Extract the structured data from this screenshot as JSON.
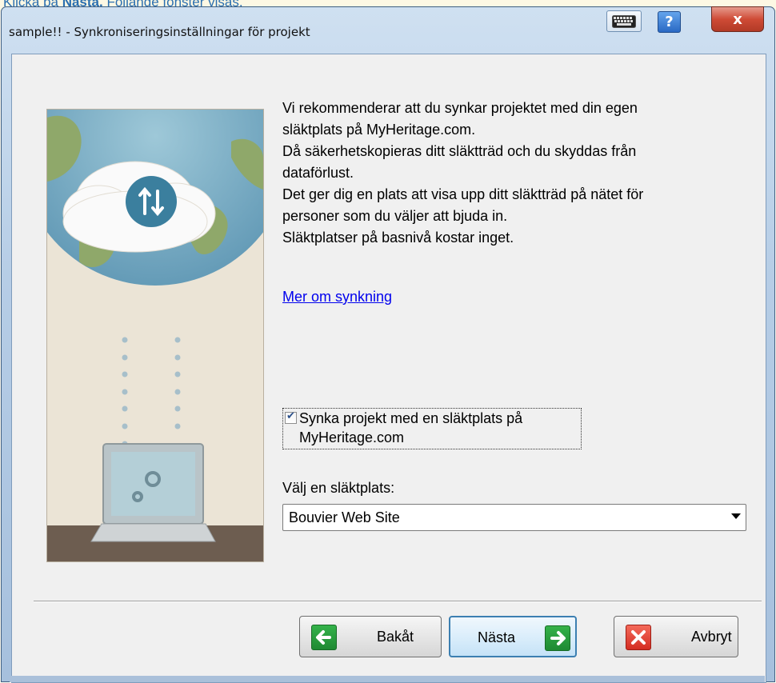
{
  "doc_banner": {
    "pre": "Klicka på ",
    "bold": "Nästa.",
    "post": " Följande fönster visas."
  },
  "window": {
    "title": "sample!! - Synkroniseringsinställningar för projekt",
    "help_label": "?",
    "close_label": "x"
  },
  "description": [
    "Vi rekommenderar att du synkar projektet med din egen",
    "släktplats på MyHeritage.com.",
    "Då säkerhetskopieras ditt släktträd och du skyddas från",
    "dataförlust.",
    "Det ger dig en plats att visa upp ditt släktträd på nätet för",
    "personer som du väljer att bjuda in.",
    "Släktplatser på basnivå kostar inget."
  ],
  "more_link": "Mer om synkning",
  "sync_checkbox": {
    "checked": true,
    "label_line1": "Synka projekt med en släktplats på",
    "label_line2": "MyHeritage.com"
  },
  "site": {
    "label": "Välj en släktplats:",
    "selected": "Bouvier Web Site"
  },
  "buttons": {
    "back": "Bakåt",
    "next": "Nästa",
    "cancel": "Avbryt"
  },
  "colors": {
    "accent": "#3c7fb1",
    "link": "#0000ee",
    "ok_green": "#1f8a33",
    "cancel_red": "#d42d22"
  }
}
